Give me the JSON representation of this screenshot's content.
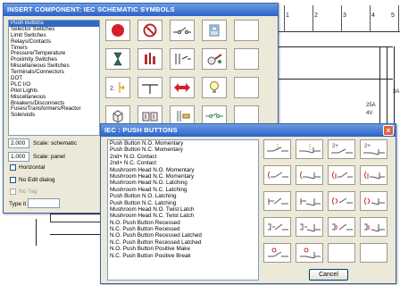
{
  "insert_component": {
    "title": "INSERT COMPONENT: IEC SCHEMATIC SYMBOLS",
    "categories": [
      "Push Buttons",
      "Selector Switches",
      "Limit Switches",
      "Relays/Contacts",
      "Timers",
      "Pressure/Temperature",
      "Proximity Switches",
      "Miscellaneous Switches",
      "Terminals/Connectors",
      "DOT",
      "PLC I/O",
      "Pilot Lights",
      "Miscellaneous",
      "Breakers/Disconnects",
      "Fuses/Transformers/Reactor",
      "Solenoids"
    ],
    "selected_category": "Push Buttons",
    "symbols": [
      {
        "name": "stop-sign-icon"
      },
      {
        "name": "no-entry-icon"
      },
      {
        "name": "switch-contact-icon"
      },
      {
        "name": "cabinet-icon"
      },
      {
        "name": "blank"
      },
      {
        "name": "hourglass-icon"
      },
      {
        "name": "pressure-gauge-icon"
      },
      {
        "name": "contact-pair-icon"
      },
      {
        "name": "key-switch-icon"
      },
      {
        "name": "blank"
      },
      {
        "name": "bracket-contacts-icon"
      },
      {
        "name": "t-junction-icon"
      },
      {
        "name": "double-arrow-icon"
      },
      {
        "name": "light-bulb-icon"
      },
      {
        "name": "blank"
      },
      {
        "name": "cube-icon"
      },
      {
        "name": "dual-cube-icon"
      },
      {
        "name": "fuse-icon"
      },
      {
        "name": "solenoid-icon"
      },
      {
        "name": "blank"
      }
    ],
    "scale_schematic_value": "2.000",
    "scale_schematic_label": "Scale: schematic",
    "scale_panel_value": "1.000",
    "scale_panel_label": "Scale: panel",
    "horizontal_label": "Horizontal",
    "no_edit_label": "No Edit dialog",
    "no_tag_label": "No Tag",
    "type_it_label": "Type it"
  },
  "push_buttons": {
    "title": "IEC : PUSH BUTTONS",
    "items": [
      "Push Button N.O. Momentary",
      "Push Button N.C. Momentary",
      "2nd+ N.O. Contact",
      "2nd+ N.C. Contact",
      "Mushroom Head N.O. Momentary",
      "Mushroom Head N.C. Momentary",
      "Mushroom Head N.O. Latching",
      "Mushroom Head N.C. Latching",
      "Push Button N.O. Latching",
      "Push Button N.C. Latching",
      "Mushroom Head N.O. Twist Latch",
      "Mushroom Head N.C. Twist Latch",
      "N.O. Push Button Recessed",
      "N.C. Push Button Recessed",
      "N.O. Push Button Recessed Latched",
      "N.C. Push Button Recessed Latched",
      "N.O. Push Button Positive Make",
      "N.C. Push Button Positive Break"
    ],
    "symbol_badges": [
      "2+",
      "2+"
    ],
    "cancel_label": "Cancel"
  },
  "drawing": {
    "ruler_labels": [
      "1",
      "2",
      "3",
      "4",
      "5"
    ],
    "wire_labels": [
      "25A",
      "4V",
      "3A"
    ]
  }
}
